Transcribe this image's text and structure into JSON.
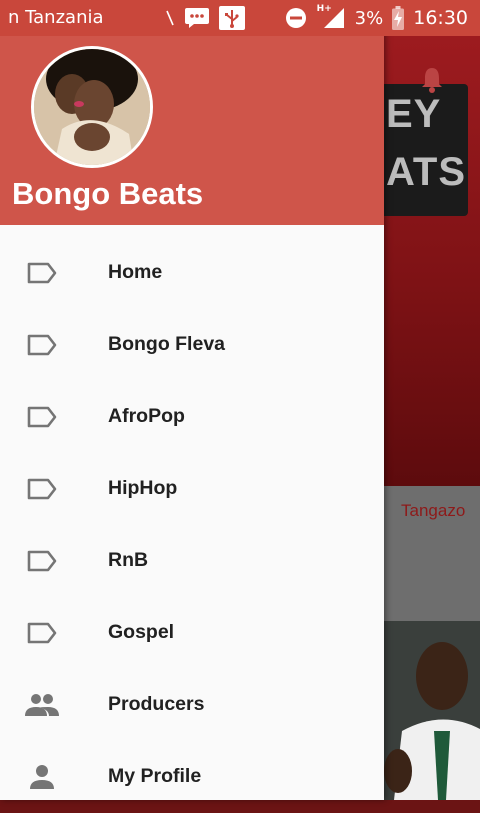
{
  "status_bar": {
    "notification_text": "n Tanzania",
    "network_label": "H+",
    "battery_percent": "3%",
    "time": "16:30"
  },
  "background": {
    "banner_text_top": "EY",
    "banner_text_bottom": "ATS",
    "side_label": "Tangazo"
  },
  "drawer": {
    "title": "Bongo Beats",
    "menu": [
      {
        "label": "Home",
        "icon": "label-icon"
      },
      {
        "label": "Bongo Fleva",
        "icon": "label-icon"
      },
      {
        "label": "AfroPop",
        "icon": "label-icon"
      },
      {
        "label": "HipHop",
        "icon": "label-icon"
      },
      {
        "label": "RnB",
        "icon": "label-icon"
      },
      {
        "label": "Gospel",
        "icon": "label-icon"
      },
      {
        "label": "Producers",
        "icon": "people-icon"
      },
      {
        "label": "My Profile",
        "icon": "person-icon"
      }
    ]
  },
  "colors": {
    "status_bar": "#c9473b",
    "drawer_header": "#cf554a",
    "drawer_bg": "#fafafa",
    "menu_text": "#212121",
    "icon": "#757575"
  }
}
